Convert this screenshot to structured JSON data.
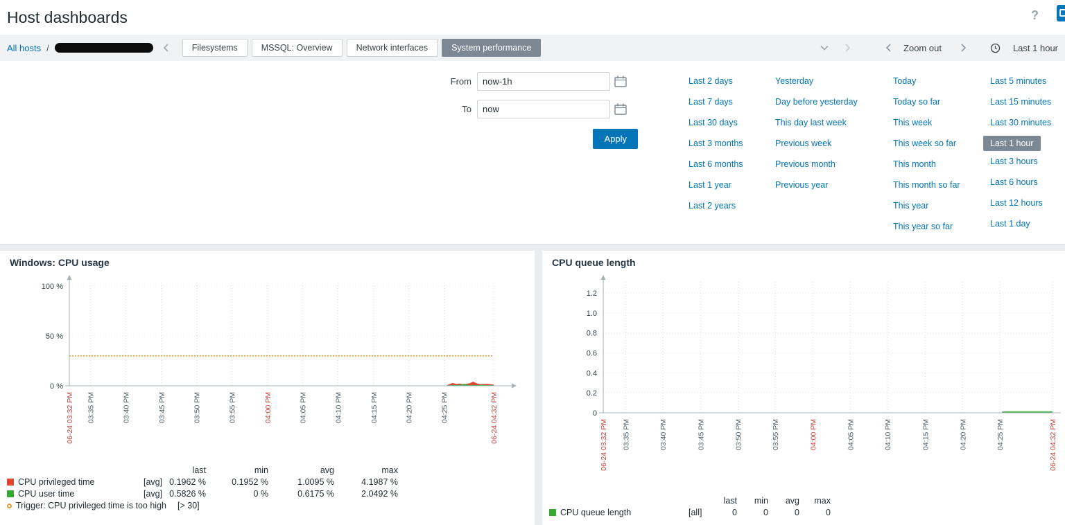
{
  "colors": {
    "link_blue": "#0275b8",
    "selected_gray": "#7c8894",
    "apply_blue": "#0275b8",
    "series_red": "#de4632",
    "series_green": "#33a933",
    "trigger_orange": "#dd9933",
    "axis_red": "#c5443c"
  },
  "header": {
    "title": "Host dashboards",
    "help_glyph": "?"
  },
  "breadcrumb": {
    "all_hosts": "All hosts",
    "separator": "/"
  },
  "tabs": [
    {
      "label": "Filesystems",
      "active": false
    },
    {
      "label": "MSSQL: Overview",
      "active": false
    },
    {
      "label": "Network interfaces",
      "active": false
    },
    {
      "label": "System performance",
      "active": true
    }
  ],
  "time_controls": {
    "zoom_out_label": "Zoom out",
    "current_range": "Last 1 hour"
  },
  "time_filter": {
    "from_label": "From",
    "from_value": "now-1h",
    "to_label": "To",
    "to_value": "now",
    "apply_label": "Apply",
    "selected_range": "Last 1 hour",
    "quick_ranges": {
      "col1": [
        "Last 2 days",
        "Last 7 days",
        "Last 30 days",
        "Last 3 months",
        "Last 6 months",
        "Last 1 year",
        "Last 2 years"
      ],
      "col2": [
        "Yesterday",
        "Day before yesterday",
        "This day last week",
        "Previous week",
        "Previous month",
        "Previous year"
      ],
      "col3": [
        "Today",
        "Today so far",
        "This week",
        "This week so far",
        "This month",
        "This month so far",
        "This year",
        "This year so far"
      ],
      "col4": [
        "Last 5 minutes",
        "Last 15 minutes",
        "Last 30 minutes",
        "Last 1 hour",
        "Last 3 hours",
        "Last 6 hours",
        "Last 12 hours",
        "Last 1 day"
      ]
    }
  },
  "chart_data": [
    {
      "type": "area",
      "title": "Windows: CPU usage",
      "xlabel": "",
      "ylabel": "",
      "ylim": [
        0,
        100
      ],
      "yticks": [
        0,
        50,
        100
      ],
      "ytick_labels": [
        "0 %",
        "50 %",
        "100 %"
      ],
      "grid": true,
      "legend_position": "bottom",
      "xticks": [
        {
          "label": "06-24 03:32 PM",
          "pos": 0.0,
          "red": true
        },
        {
          "label": "03:35 PM",
          "pos": 0.05,
          "red": false
        },
        {
          "label": "03:40 PM",
          "pos": 0.133,
          "red": false
        },
        {
          "label": "03:45 PM",
          "pos": 0.217,
          "red": false
        },
        {
          "label": "03:50 PM",
          "pos": 0.3,
          "red": false
        },
        {
          "label": "03:55 PM",
          "pos": 0.383,
          "red": false
        },
        {
          "label": "04:00 PM",
          "pos": 0.467,
          "red": true
        },
        {
          "label": "04:05 PM",
          "pos": 0.55,
          "red": false
        },
        {
          "label": "04:10 PM",
          "pos": 0.633,
          "red": false
        },
        {
          "label": "04:15 PM",
          "pos": 0.717,
          "red": false
        },
        {
          "label": "04:20 PM",
          "pos": 0.8,
          "red": false
        },
        {
          "label": "04:25 PM",
          "pos": 0.883,
          "red": false
        },
        {
          "label": "06-24 04:32 PM",
          "pos": 1.0,
          "red": true
        }
      ],
      "trigger_line": {
        "value": 30,
        "color": "#dd9933"
      },
      "series": [
        {
          "name": "CPU privileged time",
          "color": "#de4632",
          "fill": true,
          "points": [
            [
              0.888,
              0.1
            ],
            [
              0.895,
              1.6
            ],
            [
              0.903,
              2.8
            ],
            [
              0.912,
              1.8
            ],
            [
              0.92,
              2.2
            ],
            [
              0.928,
              1.5
            ],
            [
              0.936,
              2.0
            ],
            [
              0.944,
              2.6
            ],
            [
              0.952,
              4.2
            ],
            [
              0.96,
              2.4
            ],
            [
              0.97,
              1.7
            ],
            [
              0.985,
              1.9
            ],
            [
              1.0,
              1.2
            ]
          ]
        },
        {
          "name": "CPU user time",
          "color": "#33a933",
          "fill": true,
          "points": [
            [
              0.888,
              0.1
            ],
            [
              0.9,
              0.9
            ],
            [
              0.912,
              0.7
            ],
            [
              0.922,
              1.2
            ],
            [
              0.93,
              2.0
            ],
            [
              0.94,
              0.9
            ],
            [
              0.955,
              0.7
            ],
            [
              0.97,
              1.0
            ],
            [
              0.985,
              0.6
            ],
            [
              1.0,
              0.6
            ]
          ]
        }
      ],
      "legend": {
        "headers": [
          "last",
          "min",
          "avg",
          "max"
        ],
        "rows": [
          {
            "marker": "square",
            "color": "#de4632",
            "name": "CPU privileged time",
            "func": "[avg]",
            "values": [
              "0.1962 %",
              "0.1952 %",
              "1.0095 %",
              "4.1987 %"
            ]
          },
          {
            "marker": "square",
            "color": "#33a933",
            "name": "CPU user time",
            "func": "[avg]",
            "values": [
              "0.5826 %",
              "0 %",
              "0.6175 %",
              "2.0492 %"
            ]
          },
          {
            "marker": "circle",
            "color": "#dd9933",
            "name": "Trigger: CPU privileged time is too high",
            "func": "[> 30]",
            "values": []
          }
        ]
      }
    },
    {
      "type": "line",
      "title": "CPU queue length",
      "xlabel": "",
      "ylabel": "",
      "ylim": [
        0,
        1.2
      ],
      "yticks": [
        0,
        0.2,
        0.4,
        0.6,
        0.8,
        1.0,
        1.2
      ],
      "ytick_labels": [
        "0",
        "0.2",
        "0.4",
        "0.6",
        "0.8",
        "1.0",
        "1.2"
      ],
      "grid": true,
      "legend_position": "bottom",
      "xticks": [
        {
          "label": "06-24 03:32 PM",
          "pos": 0.0,
          "red": true
        },
        {
          "label": "03:35 PM",
          "pos": 0.05,
          "red": false
        },
        {
          "label": "03:40 PM",
          "pos": 0.133,
          "red": false
        },
        {
          "label": "03:45 PM",
          "pos": 0.217,
          "red": false
        },
        {
          "label": "03:50 PM",
          "pos": 0.3,
          "red": false
        },
        {
          "label": "03:55 PM",
          "pos": 0.383,
          "red": false
        },
        {
          "label": "04:00 PM",
          "pos": 0.467,
          "red": true
        },
        {
          "label": "04:05 PM",
          "pos": 0.55,
          "red": false
        },
        {
          "label": "04:10 PM",
          "pos": 0.633,
          "red": false
        },
        {
          "label": "04:15 PM",
          "pos": 0.717,
          "red": false
        },
        {
          "label": "04:20 PM",
          "pos": 0.8,
          "red": false
        },
        {
          "label": "04:25 PM",
          "pos": 0.883,
          "red": false
        },
        {
          "label": "06-24 04:32 PM",
          "pos": 1.0,
          "red": true
        }
      ],
      "series": [
        {
          "name": "CPU queue length",
          "color": "#33a933",
          "fill": false,
          "points": [
            [
              0.888,
              0
            ],
            [
              1.0,
              0
            ]
          ]
        }
      ],
      "legend": {
        "headers": [
          "last",
          "min",
          "avg",
          "max"
        ],
        "rows": [
          {
            "marker": "square",
            "color": "#33a933",
            "name": "CPU queue length",
            "func": "[all]",
            "values": [
              "0",
              "0",
              "0",
              "0"
            ]
          }
        ]
      }
    }
  ]
}
